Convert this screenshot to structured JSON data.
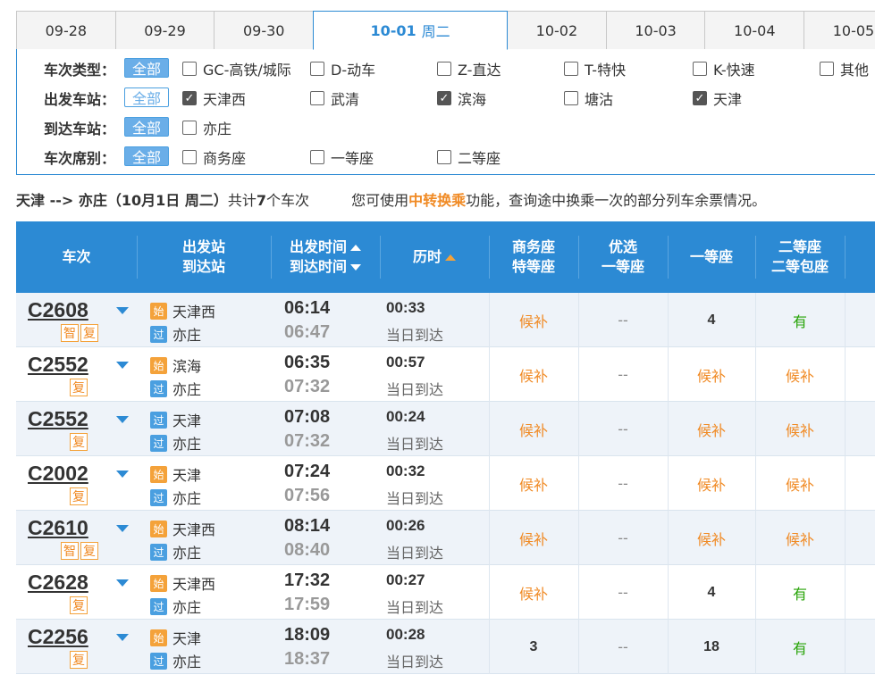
{
  "date_tabs": [
    {
      "label": "09-28"
    },
    {
      "label": "09-29"
    },
    {
      "label": "09-30"
    },
    {
      "label": "10-01",
      "weekday": "周二",
      "active": true
    },
    {
      "label": "10-02"
    },
    {
      "label": "10-03"
    },
    {
      "label": "10-04"
    },
    {
      "label": "10-05"
    }
  ],
  "filters": {
    "type": {
      "label": "车次类型：",
      "all": "全部",
      "options": [
        "GC-高铁/城际",
        "D-动车",
        "Z-直达",
        "T-特快",
        "K-快速",
        "其他"
      ]
    },
    "departure": {
      "label": "出发车站：",
      "all": "全部",
      "options": [
        {
          "label": "天津西",
          "checked": true
        },
        {
          "label": "武清",
          "checked": false
        },
        {
          "label": "滨海",
          "checked": true
        },
        {
          "label": "塘沽",
          "checked": false
        },
        {
          "label": "天津",
          "checked": true
        }
      ]
    },
    "arrival": {
      "label": "到达车站：",
      "all": "全部",
      "options": [
        {
          "label": "亦庄",
          "checked": false
        }
      ]
    },
    "seat": {
      "label": "车次席别：",
      "all": "全部",
      "options": [
        "商务座",
        "一等座",
        "二等座"
      ]
    }
  },
  "summary": {
    "route": "天津 --> 亦庄（",
    "date_bold": "10月1日",
    "weekday": "  周二）",
    "count_prefix": "共计",
    "count": "7",
    "count_suffix": "个车次",
    "tip_prefix": "您可使用",
    "tip_link": "中转换乘",
    "tip_suffix": "功能，查询途中换乘一次的部分列车余票情况。"
  },
  "table": {
    "headers": {
      "train": "车次",
      "station_1": "出发站",
      "station_2": "到达站",
      "time_1": "出发时间",
      "time_2": "到达时间",
      "duration": "历时",
      "business_1": "商务座",
      "business_2": "特等座",
      "premium_1": "优选",
      "premium_2": "一等座",
      "first": "一等座",
      "second_1": "二等座",
      "second_2": "二等包座"
    },
    "rows": [
      {
        "train": "C2608",
        "tags": [
          "智",
          "复"
        ],
        "from_type": "始",
        "from": "天津西",
        "to_type": "过",
        "to": "亦庄",
        "dep": "06:14",
        "arr": "06:47",
        "duration": "00:33",
        "arrive_day": "当日到达",
        "business": "候补",
        "premium": "--",
        "first": "4",
        "second": "有"
      },
      {
        "train": "C2552",
        "tags": [
          "复"
        ],
        "from_type": "始",
        "from": "滨海",
        "to_type": "过",
        "to": "亦庄",
        "dep": "06:35",
        "arr": "07:32",
        "duration": "00:57",
        "arrive_day": "当日到达",
        "business": "候补",
        "premium": "--",
        "first": "候补",
        "second": "候补"
      },
      {
        "train": "C2552",
        "tags": [
          "复"
        ],
        "from_type": "过",
        "from": "天津",
        "to_type": "过",
        "to": "亦庄",
        "dep": "07:08",
        "arr": "07:32",
        "duration": "00:24",
        "arrive_day": "当日到达",
        "business": "候补",
        "premium": "--",
        "first": "候补",
        "second": "候补"
      },
      {
        "train": "C2002",
        "tags": [
          "复"
        ],
        "from_type": "始",
        "from": "天津",
        "to_type": "过",
        "to": "亦庄",
        "dep": "07:24",
        "arr": "07:56",
        "duration": "00:32",
        "arrive_day": "当日到达",
        "business": "候补",
        "premium": "--",
        "first": "候补",
        "second": "候补"
      },
      {
        "train": "C2610",
        "tags": [
          "智",
          "复"
        ],
        "from_type": "始",
        "from": "天津西",
        "to_type": "过",
        "to": "亦庄",
        "dep": "08:14",
        "arr": "08:40",
        "duration": "00:26",
        "arrive_day": "当日到达",
        "business": "候补",
        "premium": "--",
        "first": "候补",
        "second": "候补"
      },
      {
        "train": "C2628",
        "tags": [
          "复"
        ],
        "from_type": "始",
        "from": "天津西",
        "to_type": "过",
        "to": "亦庄",
        "dep": "17:32",
        "arr": "17:59",
        "duration": "00:27",
        "arrive_day": "当日到达",
        "business": "候补",
        "premium": "--",
        "first": "4",
        "second": "有"
      },
      {
        "train": "C2256",
        "tags": [
          "复"
        ],
        "from_type": "始",
        "from": "天津",
        "to_type": "过",
        "to": "亦庄",
        "dep": "18:09",
        "arr": "18:37",
        "duration": "00:28",
        "arrive_day": "当日到达",
        "business": "3",
        "premium": "--",
        "first": "18",
        "second": "有"
      }
    ]
  },
  "colors": {
    "accent_blue": "#2c8ad4",
    "orange": "#f08a24",
    "available_green": "#26a306"
  }
}
